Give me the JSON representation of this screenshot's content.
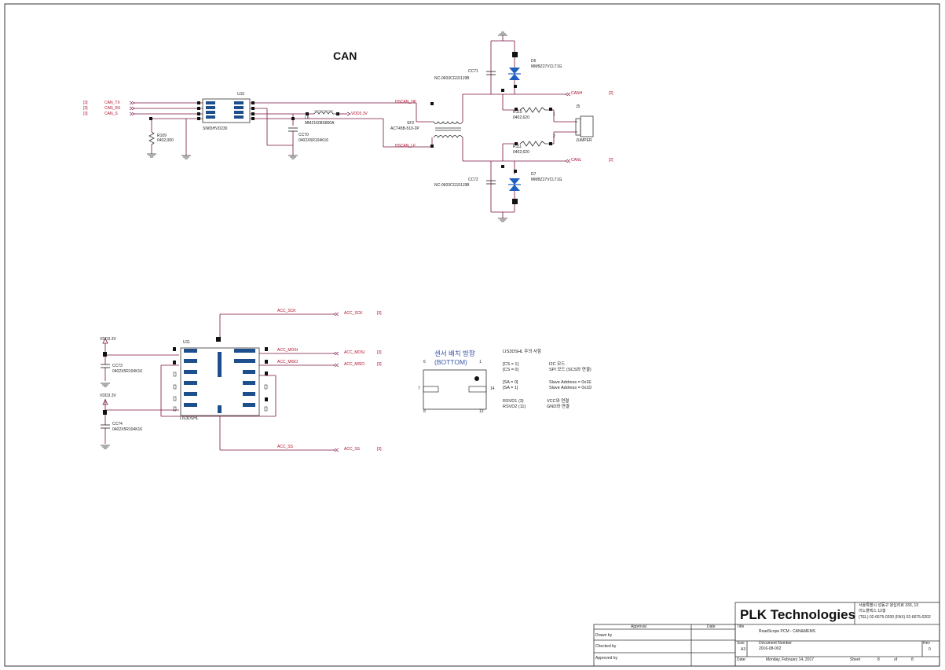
{
  "section_titles": {
    "can": "CAN"
  },
  "can": {
    "ports": [
      "CAN_TX",
      "CAN_RX",
      "CAN_S"
    ],
    "port_ref": "[3]",
    "u10": {
      "ref": "U10",
      "part": "SN65HVD230"
    },
    "r109": {
      "ref": "R109",
      "value": "0402,000"
    },
    "l6": {
      "ref": "L6",
      "part": "MMZ1608S800A"
    },
    "vdd": "VDD3.3V",
    "cc70": {
      "ref": "CC70",
      "part": "0402X5R104K16"
    },
    "nets": {
      "hscan_hf": "HSCAN_HF",
      "hscan_lf": "HSCAN_LF"
    },
    "sf2": {
      "ref": "SF2",
      "part": "ACT45B-510-2P"
    },
    "cc71": {
      "ref": "CC71",
      "part": "NC-0603CG151J9B"
    },
    "cc72": {
      "ref": "CC72",
      "part": "NC-0603CG151J9B"
    },
    "d6": {
      "ref": "D6",
      "part": "MMBZ27VCLT1G"
    },
    "d7": {
      "ref": "D7",
      "part": "MMBZ27VCLT1G"
    },
    "r110": {
      "ref": "R110",
      "value": "0402,620"
    },
    "r111": {
      "ref": "R111",
      "value": "0402,620"
    },
    "canh": "CANH",
    "canl": "CANL",
    "out_ref": "[2]",
    "j5": {
      "ref": "J5",
      "part": "JUMPER",
      "pin1": "1",
      "pin2": "2"
    }
  },
  "accel": {
    "u11": {
      "ref": "U11",
      "part": "LIS3DSHL"
    },
    "vdd1": "VDD3.3V",
    "vdd2": "VDD3.3V",
    "cc73": {
      "ref": "CC73",
      "part": "0402X5R104K16"
    },
    "cc74": {
      "ref": "CC74",
      "part": "0402X5R104K16"
    },
    "net_labels": [
      "ACC_SCK",
      "ACC_MOSI",
      "ACC_MISO",
      "ACC_SS"
    ],
    "port_ref": "[3]"
  },
  "sensor_note": {
    "heading_line1": "센서 배치 방향",
    "heading_line2": "(BOTTOM)",
    "pin_tl": "6",
    "pin_tr": "1",
    "pin_ml": "7",
    "pin_mr": "14",
    "pin_bl": "8",
    "pin_br": "13",
    "title": "LIS3DSHL 주의 사항",
    "rows": [
      {
        "left": "[CS = 1]",
        "right": "I2C 모드"
      },
      {
        "left": "[CS = 0]",
        "right": "SPI 모드 (SCS와 연결)"
      },
      {
        "left": "[SA = 0]",
        "right": "Slave Address = 0x1E"
      },
      {
        "left": "[SA = 1]",
        "right": "Slave Address = 0x1D"
      },
      {
        "left": "RSVD1 (3)",
        "right": "VCC와 연결"
      },
      {
        "left": "RSVD2 (11)",
        "right": "GND와 연결"
      }
    ]
  },
  "title_block": {
    "company": "PLK Technologies",
    "address_line1": "서울특별시 성동구 왕십리로 333, 13",
    "address_line2": "이노플렉스 12층",
    "contact": "(TEL) 02-6675-0200   (FAX) 02-6675-0202",
    "approval_header": "Approval",
    "date_header": "Date",
    "drawn_by": "Drawn by",
    "checked_by": "Checked by",
    "approved_by": "Approved by",
    "title_label": "Title",
    "title_value": "RoadScope PCM - CAN&MEMS",
    "size_label": "Size",
    "size_value": "A3",
    "doc_label": "Document Number",
    "doc_value": "2016-08-002",
    "rev_label": "Rev",
    "rev_value": "0",
    "date_label": "Date:",
    "date_value": "Monday, February 14, 2017",
    "sheet_label": "Sheet",
    "sheet_value": "8",
    "of_label": "of",
    "of_value": "8"
  }
}
